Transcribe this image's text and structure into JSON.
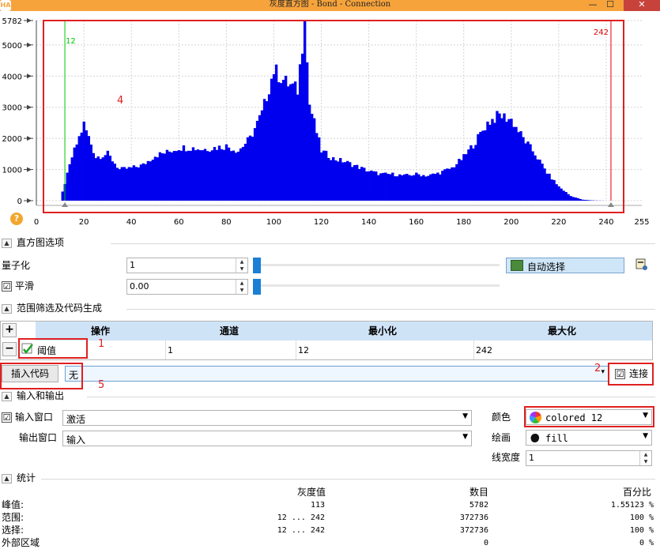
{
  "window": {
    "title": "灰度直方图 - Bond - Connection",
    "app_icon": "HA",
    "minimize": "—",
    "maximize": "☐",
    "close": "✕"
  },
  "histogram": {
    "y_ticks": [
      "5782",
      "5000",
      "4000",
      "3000",
      "2000",
      "1000",
      "0"
    ],
    "x_ticks": [
      "0",
      "20",
      "40",
      "60",
      "80",
      "100",
      "120",
      "140",
      "160",
      "180",
      "200",
      "220",
      "240",
      "255"
    ],
    "threshold_min_label": "12",
    "threshold_max_label": "242",
    "annotation": "4",
    "colors": {
      "bars": "#0000ee",
      "min_line": "#00c800",
      "max_line": "#e00000",
      "annotation": "#e02020"
    }
  },
  "chart_data": {
    "type": "bar",
    "x": [
      10,
      15,
      20,
      25,
      30,
      35,
      40,
      45,
      50,
      55,
      60,
      65,
      70,
      75,
      80,
      85,
      90,
      95,
      100,
      105,
      110,
      113,
      115,
      120,
      125,
      130,
      135,
      140,
      145,
      150,
      155,
      160,
      165,
      170,
      175,
      180,
      185,
      190,
      195,
      200,
      205,
      210,
      215,
      220,
      225,
      230,
      235,
      240,
      242
    ],
    "values": [
      0,
      1400,
      2450,
      1400,
      1500,
      1000,
      1050,
      1150,
      1450,
      1550,
      1700,
      1700,
      1650,
      1700,
      1750,
      1600,
      2000,
      2800,
      4200,
      3800,
      3550,
      5782,
      3100,
      1600,
      1350,
      1250,
      1100,
      950,
      850,
      850,
      800,
      850,
      800,
      900,
      1050,
      1400,
      1900,
      2500,
      2750,
      2600,
      2000,
      1500,
      900,
      450,
      150,
      30,
      5,
      0,
      0
    ],
    "xlim": [
      0,
      255
    ],
    "ylim": [
      0,
      5782
    ],
    "title": "",
    "xlabel": "",
    "ylabel": ""
  },
  "help_icon": "?",
  "section_histogram": {
    "title": "直方图选项"
  },
  "quantize": {
    "label": "量子化",
    "value": "1"
  },
  "smooth": {
    "label": "平滑",
    "value": "0.00",
    "checked": "☑"
  },
  "auto_select": {
    "label": "自动选择"
  },
  "section_range": {
    "title": "范围筛选及代码生成"
  },
  "table": {
    "add": "+",
    "remove": "−",
    "headers": [
      "操作",
      "通道",
      "最小化",
      "最大化"
    ],
    "row": {
      "op": "阈值",
      "channel": "1",
      "min": "12",
      "max": "242"
    }
  },
  "insert_code": {
    "label": "插入代码",
    "value": "无",
    "arrow": "▾"
  },
  "connect": {
    "label": "连接",
    "checked": "☑"
  },
  "marks": {
    "m1": "1",
    "m2": "2",
    "m5": "5"
  },
  "section_io": {
    "title": "输入和输出"
  },
  "input_window": {
    "label": "输入窗口",
    "value": "激活",
    "checked": "☑"
  },
  "output_window": {
    "label": "输出窗口",
    "value": "输入"
  },
  "color": {
    "label": "颜色",
    "value": "colored 12"
  },
  "draw": {
    "label": "绘画",
    "value": "fill"
  },
  "line_width": {
    "label": "线宽度",
    "value": "1"
  },
  "section_stats": {
    "title": "统计"
  },
  "stats": {
    "headers": [
      "灰度值",
      "数目",
      "百分比"
    ],
    "rows": [
      {
        "label": "峰值:",
        "gray": "113",
        "count": "5782",
        "pct": "1.55123 %"
      },
      {
        "label": "范围:",
        "gray": "12 ... 242",
        "count": "372736",
        "pct": "100 %"
      },
      {
        "label": "选择:",
        "gray": "12 ... 242",
        "count": "372736",
        "pct": "100 %"
      },
      {
        "label": "外部区域",
        "gray": "",
        "count": "0",
        "pct": "0 %"
      }
    ]
  }
}
